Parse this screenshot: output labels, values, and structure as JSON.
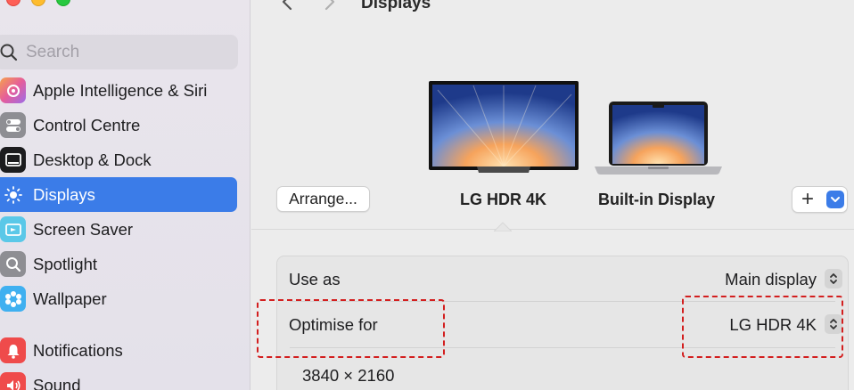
{
  "sidebar": {
    "search_placeholder": "Search",
    "items": [
      {
        "label": "Apple Intelligence & Siri",
        "icon": "apple-intelligence-icon"
      },
      {
        "label": "Control Centre",
        "icon": "control-centre-icon"
      },
      {
        "label": "Desktop & Dock",
        "icon": "desktop-dock-icon"
      },
      {
        "label": "Displays",
        "icon": "displays-icon",
        "selected": true
      },
      {
        "label": "Screen Saver",
        "icon": "screen-saver-icon"
      },
      {
        "label": "Spotlight",
        "icon": "spotlight-icon"
      },
      {
        "label": "Wallpaper",
        "icon": "wallpaper-icon"
      },
      {
        "label": "Notifications",
        "icon": "notifications-icon"
      },
      {
        "label": "Sound",
        "icon": "sound-icon"
      }
    ]
  },
  "header": {
    "title": "Displays"
  },
  "displays": {
    "arrange_label": "Arrange...",
    "monitors": [
      {
        "name": "LG HDR 4K",
        "selected": true
      },
      {
        "name": "Built-in Display",
        "selected": false
      }
    ],
    "add_label": "+"
  },
  "settings": {
    "use_as": {
      "label": "Use as",
      "value": "Main display"
    },
    "optimise_for": {
      "label": "Optimise for",
      "value": "LG HDR 4K"
    },
    "resolution": "3840 × 2160"
  },
  "colors": {
    "accent": "#3b7ce8",
    "highlight": "#d31f1f"
  }
}
